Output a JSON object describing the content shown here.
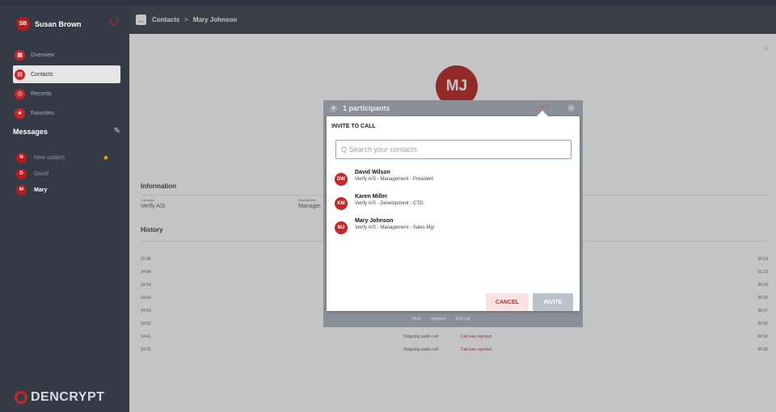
{
  "sidebar": {
    "user": {
      "initials": "SB",
      "name": "Susan Brown"
    },
    "nav": [
      {
        "label": "Overview",
        "icon": "grid-icon",
        "glyph": "▦"
      },
      {
        "label": "Contacts",
        "icon": "contacts-icon",
        "glyph": "▤"
      },
      {
        "label": "Recents",
        "icon": "clock-icon",
        "glyph": "◷"
      },
      {
        "label": "Favorites",
        "icon": "star-icon",
        "glyph": "★"
      }
    ],
    "messages_title": "Messages",
    "messages": [
      {
        "initial": "N",
        "label": "New subject",
        "starred": true
      },
      {
        "initial": "D",
        "label": "David",
        "starred": false
      },
      {
        "initial": "M",
        "label": "Mary",
        "starred": false
      }
    ],
    "brand": "DENCRYPT"
  },
  "header": {
    "section": "Contacts",
    "separator": ">",
    "contact": "Mary Johnson"
  },
  "profile": {
    "initials": "MJ",
    "information_title": "Information",
    "company_label": "Company",
    "company": "Verify A/S",
    "department_label": "Department",
    "department": "Manager"
  },
  "history": {
    "title": "History",
    "rows": [
      {
        "time": "15:38",
        "type": "",
        "status": "",
        "duration": "00:19"
      },
      {
        "time": "14:54",
        "type": "",
        "status": "",
        "duration": "01:13"
      },
      {
        "time": "14:54",
        "type": "",
        "status": "",
        "duration": "00:24"
      },
      {
        "time": "14:54",
        "type": "",
        "status": "",
        "duration": "00:22"
      },
      {
        "time": "14:53",
        "type": "",
        "status": "",
        "duration": "00:27"
      },
      {
        "time": "14:52",
        "type": "",
        "status": "",
        "duration": "00:32"
      },
      {
        "time": "14:41",
        "type": "Outgoing audio call",
        "status": "Call was rejected",
        "duration": "00:32"
      },
      {
        "time": "14:31",
        "type": "Outgoing audio call",
        "status": "Call was rejected",
        "duration": "00:32"
      }
    ]
  },
  "call": {
    "participants": "1 participants",
    "controls": [
      "Mute",
      "Speaker",
      "End call"
    ]
  },
  "invite_dialog": {
    "title": "INVITE TO CALL",
    "search_placeholder": "Q Search your contacts",
    "contacts": [
      {
        "initials": "DW",
        "name": "David Wilson",
        "detail": "Verify A/S - Management - President"
      },
      {
        "initials": "KM",
        "name": "Karen Miller",
        "detail": "Verify A/S - Development - CTO"
      },
      {
        "initials": "MJ",
        "name": "Mary Johnson",
        "detail": "Verify A/S - Management - Sales Mgr"
      }
    ],
    "cancel_label": "CANCEL",
    "invite_label": "INVITE"
  },
  "colors": {
    "accent": "#c62828",
    "sidebar": "#343a46"
  }
}
